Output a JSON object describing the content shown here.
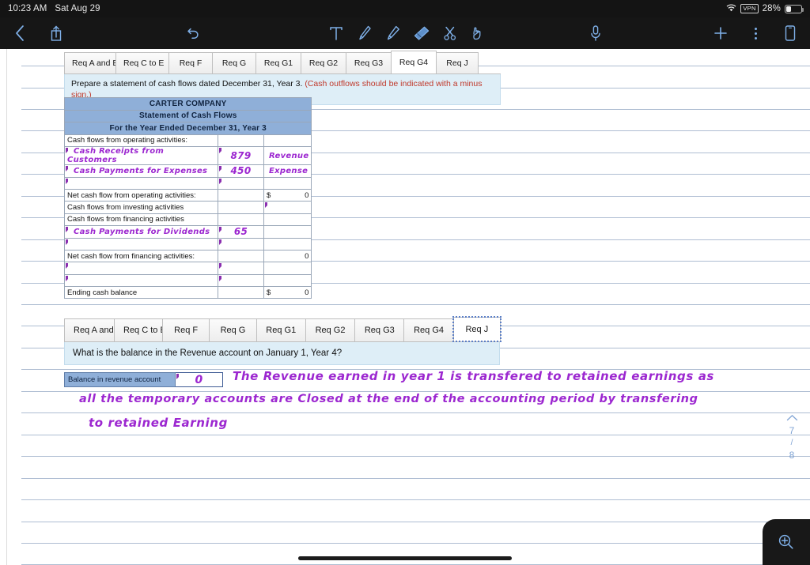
{
  "status_bar": {
    "time": "10:23 AM",
    "date": "Sat Aug 29",
    "battery_percent": "28%",
    "vpn_label": "VPN",
    "icons": [
      "wifi-icon",
      "vpn-badge",
      "battery-icon"
    ]
  },
  "toolbar": {
    "left": [
      "back-chevron-icon",
      "share-icon"
    ],
    "undo": "undo-icon",
    "tools": [
      "text-tool-icon",
      "pen-tool-icon",
      "highlighter-tool-icon",
      "eraser-tool-icon",
      "lasso-scissors-tool-icon",
      "hand-tool-icon"
    ],
    "active_tool": "eraser-tool-icon",
    "mic": "microphone-icon",
    "right": [
      "add-page-icon",
      "more-options-icon",
      "device-view-icon"
    ]
  },
  "worksheet_top": {
    "tabs": [
      "Req A and B",
      "Req C to E",
      "Req F",
      "Req G",
      "Req G1",
      "Req G2",
      "Req G3",
      "Req G4",
      "Req J"
    ],
    "active_tab": "Req G4",
    "prompt": "Prepare a statement of cash flows dated December 31, Year 3.",
    "prompt_warning": "(Cash outflows should be indicated with a minus sign.)",
    "table": {
      "title_lines": [
        "CARTER COMPANY",
        "Statement of Cash Flows",
        "For the Year Ended December 31, Year 3"
      ],
      "rows": [
        {
          "type": "section",
          "label": "Cash flows from operating activities:",
          "amount": "",
          "total": ""
        },
        {
          "type": "input",
          "label": "Cash Receipts from Customers",
          "amount": "879",
          "note": "Revenue",
          "handwritten": true
        },
        {
          "type": "input",
          "label": "Cash Payments for Expenses",
          "amount": "450",
          "note": "Expense",
          "handwritten": true
        },
        {
          "type": "input",
          "label": "",
          "amount": "",
          "note": ""
        },
        {
          "type": "total",
          "label": "Net cash flow from operating activities:",
          "amount": "",
          "dollar": "$",
          "total": "0"
        },
        {
          "type": "section-input",
          "label": "Cash flows from investing activities",
          "amount": "",
          "total": ""
        },
        {
          "type": "section",
          "label": "Cash flows from financing activities",
          "amount": "",
          "total": ""
        },
        {
          "type": "input",
          "label": "Cash Payments for Dividends",
          "amount": "65",
          "note": "",
          "handwritten": true
        },
        {
          "type": "input",
          "label": "",
          "amount": "",
          "note": ""
        },
        {
          "type": "total",
          "label": "Net cash flow from financing activities:",
          "amount": "",
          "dollar": "",
          "total": "0"
        },
        {
          "type": "input",
          "label": "",
          "amount": "",
          "note": ""
        },
        {
          "type": "input",
          "label": "",
          "amount": "",
          "note": ""
        },
        {
          "type": "total",
          "label": "Ending cash balance",
          "amount": "",
          "dollar": "$",
          "total": "0"
        }
      ]
    }
  },
  "worksheet_bottom": {
    "tabs": [
      "Req A and B",
      "Req C to E",
      "Req F",
      "Req G",
      "Req G1",
      "Req G2",
      "Req G3",
      "Req G4",
      "Req J"
    ],
    "active_tab": "Req J",
    "prompt": "What is the balance in the Revenue account on January 1, Year 4?",
    "field_label": "Balance in revenue account",
    "field_value": "0"
  },
  "handwritten_note": {
    "lines": [
      "The Revenue earned in year 1 is transfered to retained earnings as",
      "all the temporary accounts are Closed at the end of the accounting period by transfering",
      "to retained Earning"
    ]
  },
  "right_rail": {
    "scroll_up": "chevron-up-icon",
    "current_page": "7",
    "separator": "/",
    "total_pages": "8",
    "zoom_button": "zoom-in-magnifier-icon"
  },
  "colors": {
    "accent_blue": "#7fb0e8",
    "ink_purple": "#9c27d0",
    "table_header": "#8fafd8",
    "prompt_bg": "#deeef7",
    "warning_red": "#c0392b"
  }
}
